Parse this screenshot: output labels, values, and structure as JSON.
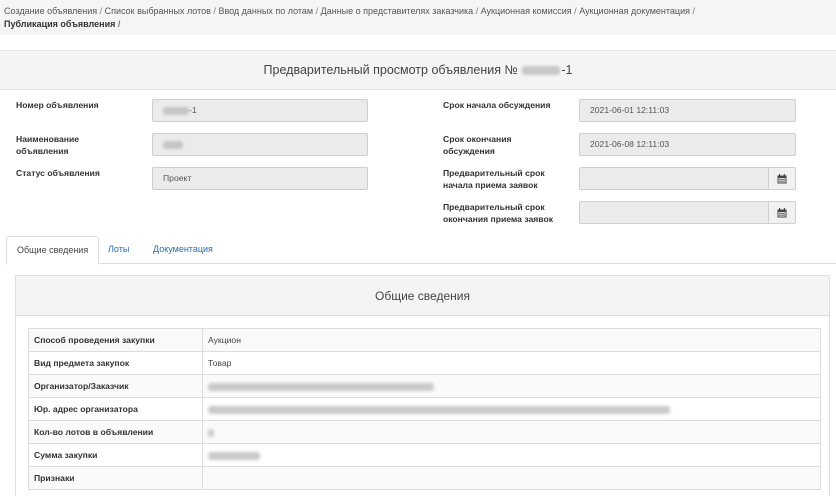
{
  "breadcrumbs": {
    "items": [
      {
        "label": "Создание объявления",
        "sep": " / "
      },
      {
        "label": "Список выбранных лотов",
        "sep": " / "
      },
      {
        "label": "Ввод данных по лотам",
        "sep": " / "
      },
      {
        "label": "Данные о представителях заказчика",
        "sep": " / "
      },
      {
        "label": "Аукционная комиссия",
        "sep": " / "
      },
      {
        "label": "Аукционная документация",
        "sep": " / "
      },
      {
        "label": "Публикация объявления",
        "sep": " / "
      }
    ]
  },
  "header": {
    "title_prefix": "Предварительный просмотр объявления №",
    "title_suffix": "-1"
  },
  "form": {
    "number_label": "Номер объявления",
    "number_value_suffix": "-1",
    "name_label": "Наименование объявления",
    "status_label": "Статус объявления",
    "status_value": "Проект",
    "discuss_start_label": "Срок начала обсуждения",
    "discuss_start_value": "2021-06-01 12:11:03",
    "discuss_end_label": "Срок окончания обсуждения",
    "discuss_end_value": "2021-06-08 12:11:03",
    "prelim_start_label": "Предварительный срок начала приема заявок",
    "prelim_start_value": "",
    "prelim_end_label": "Предварительный срок окончания приема заявок",
    "prelim_end_value": ""
  },
  "tabs": [
    {
      "label": "Общие сведения",
      "active": true
    },
    {
      "label": "Лоты",
      "active": false
    },
    {
      "label": "Документация",
      "active": false
    }
  ],
  "general": {
    "panel_title": "Общие сведения",
    "rows": [
      {
        "key": "Способ проведения закупки",
        "value": "Аукцион"
      },
      {
        "key": "Вид предмета закупок",
        "value": "Товар"
      },
      {
        "key": "Организатор/Заказчик",
        "value": ""
      },
      {
        "key": "Юр. адрес организатора",
        "value": ""
      },
      {
        "key": "Кол-во лотов в объявлении",
        "value": ""
      },
      {
        "key": "Сумма закупки",
        "value": ""
      },
      {
        "key": "Признаки",
        "value": ""
      }
    ]
  },
  "icons": {
    "calendar": "calendar-icon"
  }
}
